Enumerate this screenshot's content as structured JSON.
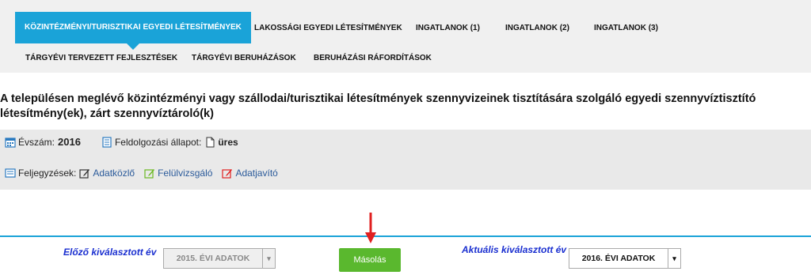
{
  "tabs_row1": [
    {
      "label": "KÖZINTÉZMÉNYI/TURISZTIKAI EGYEDI LÉTESÍTMÉNYEK",
      "active": true
    },
    {
      "label": "LAKOSSÁGI EGYEDI LÉTESÍTMÉNYEK"
    },
    {
      "label": "INGATLANOK (1)"
    },
    {
      "label": "INGATLANOK (2)"
    },
    {
      "label": "INGATLANOK (3)"
    }
  ],
  "tabs_row2": [
    {
      "label": "TÁRGYÉVI TERVEZETT FEJLESZTÉSEK"
    },
    {
      "label": "TÁRGYÉVI BERUHÁZÁSOK"
    },
    {
      "label": "BERUHÁZÁSI RÁFORDÍTÁSOK"
    }
  ],
  "title": "A településen meglévő közintézményi vagy szállodai/turisztikai létesítmények szennyvizeinek tisztítására szolgáló egyedi szennyvíztisztító létesítmény(ek), zárt szennyvíztároló(k)",
  "info": {
    "year_label": "Évszám:",
    "year_value": "2016",
    "status_label": "Feldolgozási állapot:",
    "status_value": "üres",
    "notes_label": "Feljegyzések:",
    "notes_links": [
      "Adatközlő",
      "Felülvizsgáló",
      "Adatjavító"
    ]
  },
  "copy": {
    "prev_label": "Előző kiválasztott év",
    "prev_value": "2015. ÉVI ADATOK",
    "button_label": "Másolás",
    "current_label": "Aktuális kiválasztott év",
    "current_value": "2016. ÉVI ADATOK"
  },
  "colors": {
    "accent": "#1aa3d8",
    "button": "#5ab82e",
    "label_blue": "#1a2fd0",
    "arrow": "#e02020"
  }
}
